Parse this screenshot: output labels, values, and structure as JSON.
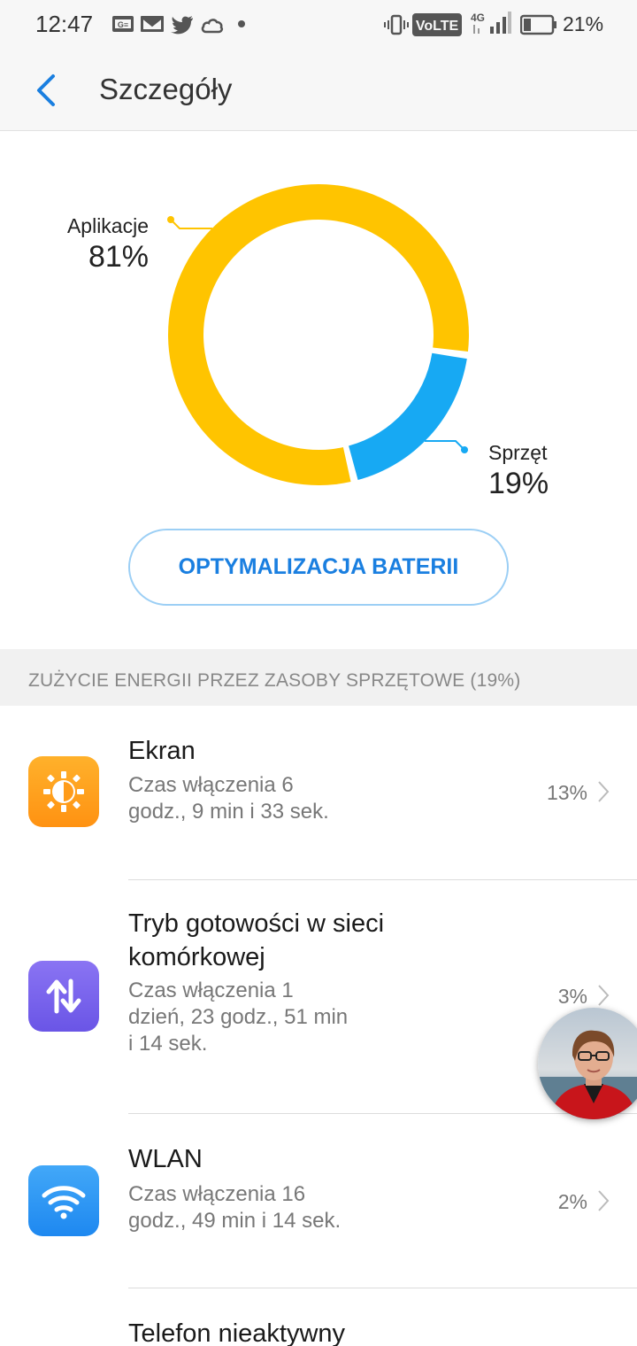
{
  "status_bar": {
    "time": "12:47",
    "battery_percent": "21%",
    "network_type": "4G",
    "volte": "VoLTE",
    "left_icons": [
      "gmail-icon",
      "gmail-icon",
      "twitter-icon",
      "weather-icon",
      "dot-icon"
    ],
    "right_icons": [
      "vibrate-icon",
      "volte-icon",
      "signal-icon",
      "battery-icon"
    ]
  },
  "app_bar": {
    "title": "Szczegóły",
    "back_icon": "chevron-left-icon"
  },
  "chart_data": {
    "type": "pie",
    "style": "donut",
    "categories": [
      "Aplikacje",
      "Sprzęt"
    ],
    "values": [
      81,
      19
    ],
    "labels": [
      "81%",
      "19%"
    ],
    "colors": [
      "#ffc400",
      "#17a9f3"
    ]
  },
  "chart_labels": {
    "apps": {
      "caption": "Aplikacje",
      "value": "81%"
    },
    "hardware": {
      "caption": "Sprzęt",
      "value": "19%"
    }
  },
  "optimize_button": {
    "label": "OPTYMALIZACJA BATERII"
  },
  "section": {
    "header": "ZUŻYCIE ENERGII PRZEZ ZASOBY SPRZĘTOWE (19%)"
  },
  "items": [
    {
      "title": "Ekran",
      "subtitle": "Czas włączenia 6 godz., 9 min i 33 sek.",
      "value": "13%",
      "icon": "brightness-icon",
      "color": "#ffa21a"
    },
    {
      "title": "Tryb gotowości w sieci komórkowej",
      "subtitle": "Czas włączenia 1 dzień, 23 godz., 51 min i 14 sek.",
      "value": "3%",
      "icon": "data-transfer-icon",
      "color": "#7161ec"
    },
    {
      "title": "WLAN",
      "subtitle": "Czas włączenia 16 godz., 49 min i 14 sek.",
      "value": "2%",
      "icon": "wifi-icon",
      "color": "#2196f3"
    },
    {
      "title": "Telefon nieaktywny",
      "subtitle": "",
      "value": "",
      "icon": "",
      "color": ""
    }
  ],
  "floating": {
    "avatar_icon": "avatar-bubble"
  }
}
